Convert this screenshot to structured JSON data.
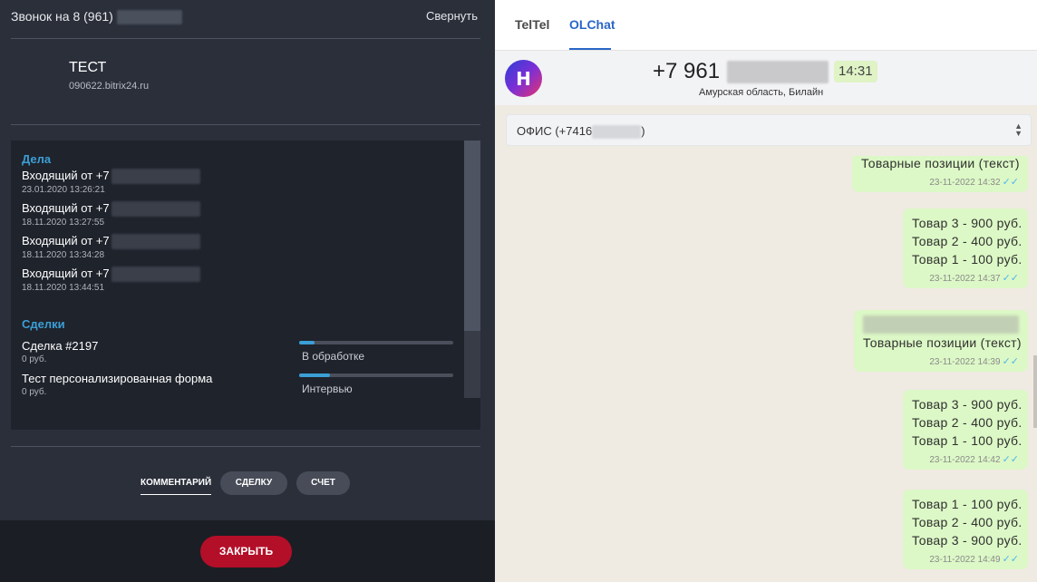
{
  "call": {
    "title_prefix": "Звонок на 8 (961)",
    "collapse_label": "Свернуть",
    "contact_name": "ТЕСТ",
    "contact_domain": "090622.bitrix24.ru"
  },
  "activities": {
    "title": "Дела",
    "items": [
      {
        "title": "Входящий от +7",
        "date": "23.01.2020 13:26:21"
      },
      {
        "title": "Входящий от +7",
        "date": "18.11.2020 13:27:55"
      },
      {
        "title": "Входящий от +7",
        "date": "18.11.2020 13:34:28"
      },
      {
        "title": "Входящий от +7",
        "date": "18.11.2020 13:44:51"
      }
    ]
  },
  "deals": {
    "title": "Сделки",
    "items": [
      {
        "title": "Сделка #2197",
        "sum": "0 руб.",
        "stage": "В обработке",
        "progress": 0.1
      },
      {
        "title": "Тест персонализированная форма",
        "sum": "0 руб.",
        "stage": "Интервью",
        "progress": 0.2
      }
    ]
  },
  "actions": {
    "comment_label": "КОММЕНТАРИЙ",
    "deal_label": "СДЕЛКУ",
    "invoice_label": "СЧЕТ",
    "close_label": "ЗАКРЫТЬ"
  },
  "right_tabs": [
    "TelTel",
    "OLChat"
  ],
  "chat_header": {
    "avatar_letter": "H",
    "phone_prefix": "+7 961",
    "region": "Амурская область, Билайн",
    "time": "14:31",
    "line_prefix": "ОФИС (+7416",
    "line_suffix": ")"
  },
  "messages": [
    {
      "lines": [
        "Товарные позиции (текст)"
      ],
      "time": "23-11-2022 14:32",
      "blurred": false
    },
    {
      "lines": [
        "Товар 3 - 900 руб.",
        "Товар 2 - 400 руб.",
        "Товар 1 - 100 руб."
      ],
      "time": "23-11-2022 14:37",
      "blurred": false
    },
    {
      "lines": [
        "Товарные позиции (текст)"
      ],
      "time": "23-11-2022 14:39",
      "blurred": true
    },
    {
      "lines": [
        "Товар 3 - 900 руб.",
        "Товар 2 - 400 руб.",
        "Товар 1 - 100 руб."
      ],
      "time": "23-11-2022 14:42",
      "blurred": false
    },
    {
      "lines": [
        "Товар 1 - 100 руб.",
        "Товар 2 - 400 руб.",
        "Товар 3 - 900 руб."
      ],
      "time": "23-11-2022 14:49",
      "blurred": false
    }
  ],
  "colors": {
    "accent": "#3b9fd6",
    "close_button": "#b30f28",
    "message_bubble": "#dcf8c6",
    "olchat_blue": "#2a66c8"
  }
}
